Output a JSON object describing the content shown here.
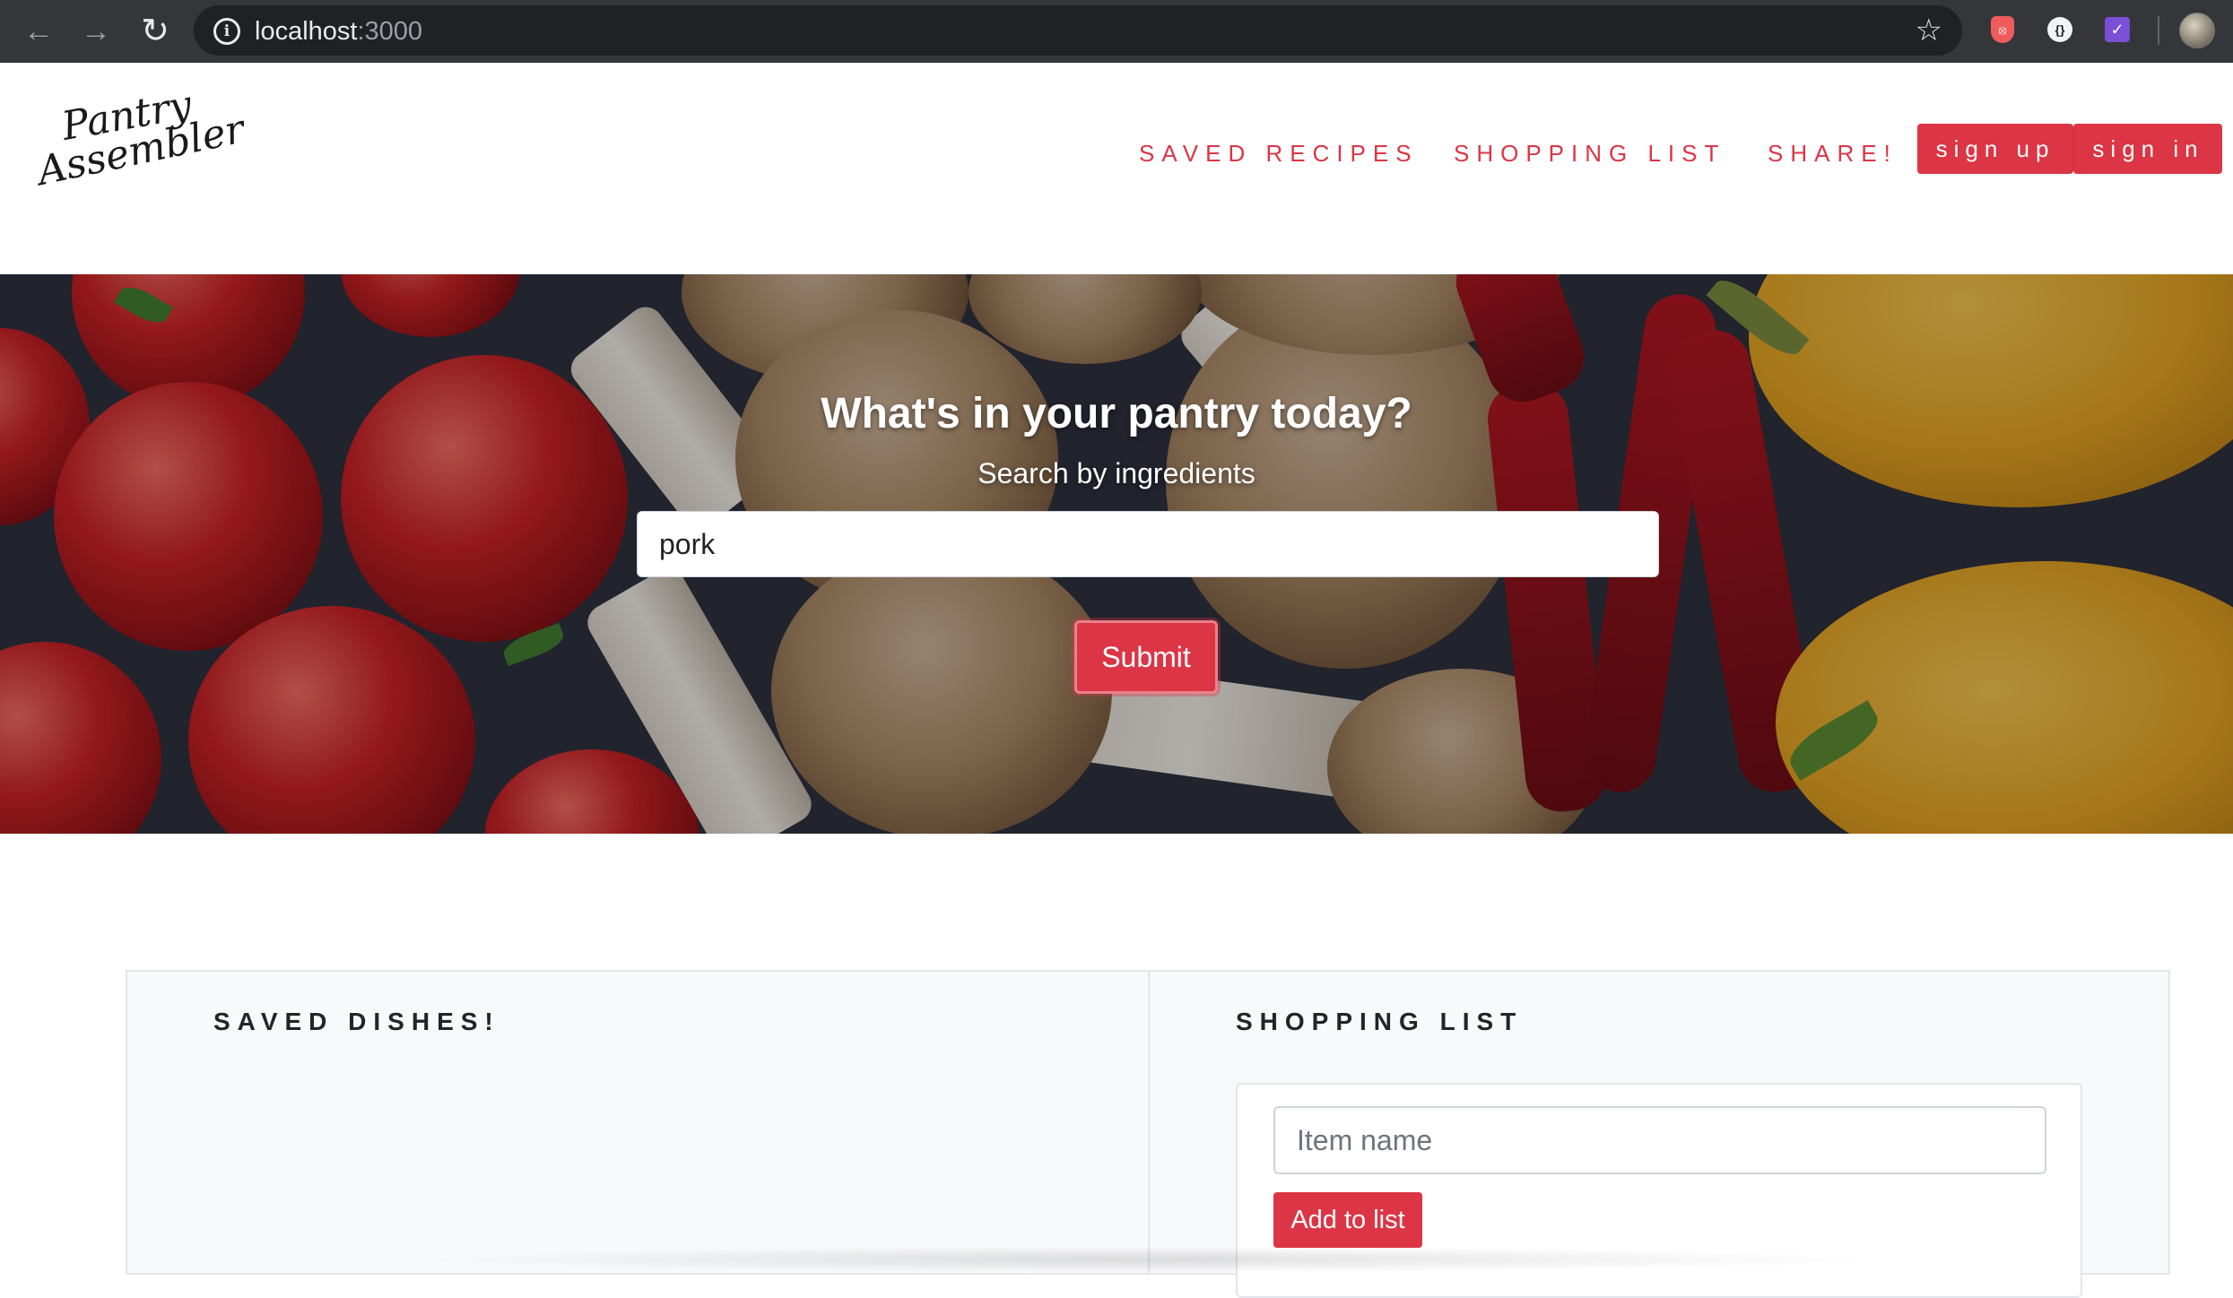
{
  "browser": {
    "back_icon": "arrow-left-icon",
    "forward_icon": "arrow-right-icon",
    "reload_icon": "reload-icon",
    "url_host": "localhost",
    "url_port": ":3000",
    "bookmark_icon": "star-icon",
    "extensions": [
      "shield-extension-icon",
      "code-extension-icon",
      "check-extension-icon"
    ]
  },
  "header": {
    "logo_line1": "Pantry",
    "logo_line2": "Assembler",
    "nav": {
      "saved_recipes": "SAVED RECIPES",
      "shopping_list": "SHOPPING LIST",
      "share": "SHARE!"
    },
    "sign_up": "sign up",
    "sign_in": "sign in"
  },
  "hero": {
    "title": "What's in your pantry today?",
    "subtitle": "Search by ingredients",
    "search_value": "pork",
    "submit_label": "Submit"
  },
  "saved_panel": {
    "title": "SAVED DISHES!"
  },
  "shopping_panel": {
    "title": "SHOPPING LIST",
    "item_placeholder": "Item name",
    "add_label": "Add to list"
  },
  "colors": {
    "accent": "#dc3545",
    "chrome_bg": "#35363a",
    "panel_bg": "#f8f9fa"
  }
}
